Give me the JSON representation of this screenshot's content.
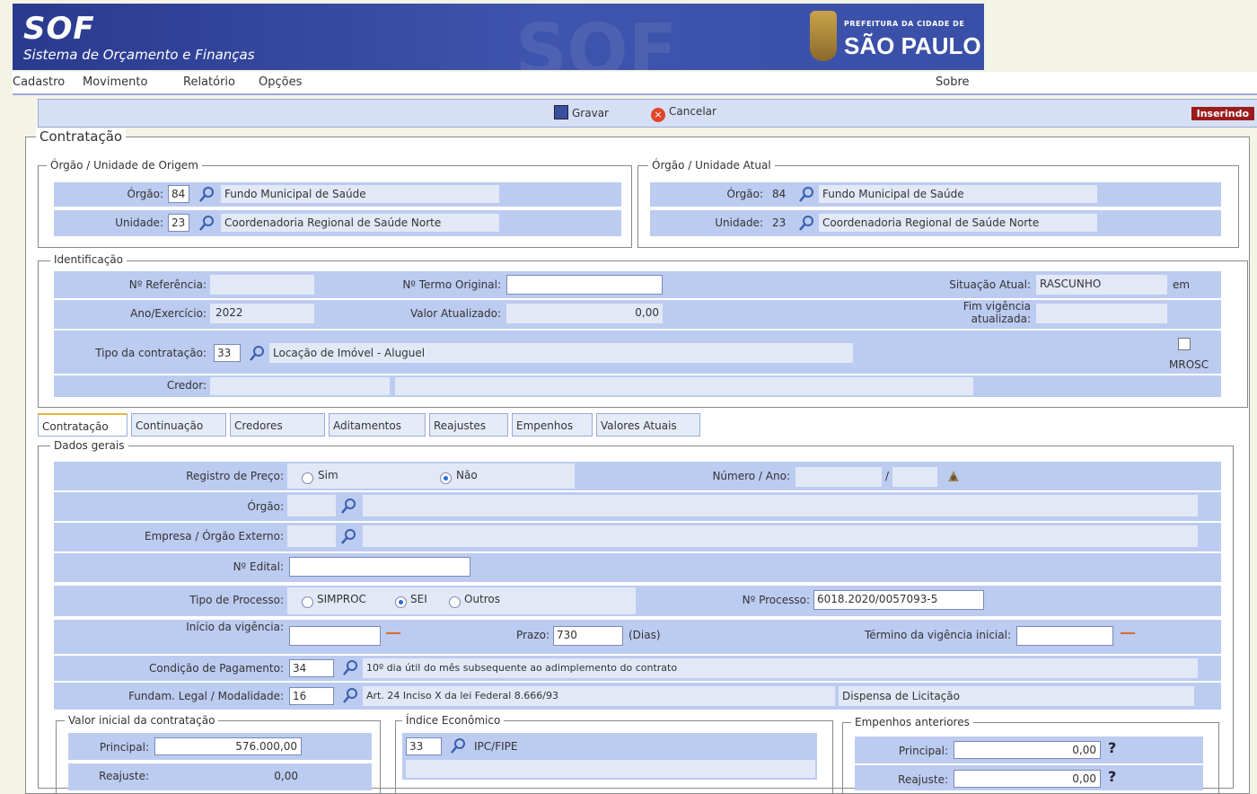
{
  "header": {
    "app_name": "SOF",
    "app_subtitle": "Sistema de Orçamento e Finanças",
    "pref_small": "PREFEITURA DA CIDADE DE",
    "pref_big": "SÃO PAULO"
  },
  "menu": {
    "cadastro": "Cadastro",
    "movimento": "Movimento",
    "relatorio": "Relatório",
    "opcoes": "Opções",
    "sobre": "Sobre"
  },
  "toolbar": {
    "save_label": "Gravar",
    "cancel_label": "Cancelar",
    "status": "Inserindo"
  },
  "contratacao_legend": "Contratação",
  "origem": {
    "legend": "Órgão / Unidade de Origem",
    "orgao_label": "Órgão:",
    "orgao_code": "84",
    "orgao_name": "Fundo Municipal de Saúde",
    "unidade_label": "Unidade:",
    "unidade_code": "23",
    "unidade_name": "Coordenadoria Regional de Saúde Norte"
  },
  "atual": {
    "legend": "Órgão / Unidade Atual",
    "orgao_label": "Órgão:",
    "orgao_code": "84",
    "orgao_name": "Fundo Municipal de Saúde",
    "unidade_label": "Unidade:",
    "unidade_code": "23",
    "unidade_name": "Coordenadoria Regional de Saúde Norte"
  },
  "identificacao": {
    "legend": "Identificação",
    "ref_label": "Nº Referência:",
    "termo_label": "Nº Termo Original:",
    "situacao_label": "Situação Atual:",
    "situacao_value": "RASCUNHO",
    "em_label": "em",
    "ano_label": "Ano/Exercício:",
    "ano_value": "2022",
    "valor_label": "Valor Atualizado:",
    "valor_value": "0,00",
    "fim_label": "Fim vigência atualizada:",
    "tipo_label": "Tipo da contratação:",
    "tipo_code": "33",
    "tipo_value": "Locação de Imóvel - Aluguel",
    "mrosc_label": "MROSC",
    "credor_label": "Credor:"
  },
  "tabs": [
    "Contratação",
    "Continuação",
    "Credores",
    "Aditamentos",
    "Reajustes",
    "Empenhos",
    "Valores Atuais"
  ],
  "dados": {
    "legend": "Dados gerais",
    "registro_label": "Registro de Preço:",
    "sim": "Sim",
    "nao": "Não",
    "numero_ano_label": "Número / Ano:",
    "slash": "/",
    "orgao_label": "Órgão:",
    "empresa_label": "Empresa / Órgão Externo:",
    "edital_label": "Nº Edital:",
    "tipo_proc_label": "Tipo de Processo:",
    "simproc": "SIMPROC",
    "sei": "SEI",
    "outros": "Outros",
    "processo_label": "Nº Processo:",
    "processo_value": "6018.2020/0057093-5",
    "inicio_label": "Início da vigência:",
    "prazo_label": "Prazo:",
    "prazo_value": "730",
    "dias": "(Dias)",
    "termino_label": "Término da vigência inicial:",
    "cond_label": "Condição de Pagamento:",
    "cond_code": "34",
    "cond_value": "10º dia útil do mês subsequente ao adimplemento do contrato",
    "fund_label": "Fundam. Legal / Modalidade:",
    "fund_code": "16",
    "fund_value": "Art. 24 Inciso X da lei Federal 8.666/93",
    "fund_extra": "Dispensa de Licitação"
  },
  "valor_inicial": {
    "legend": "Valor inicial da contratação",
    "principal_label": "Principal:",
    "principal_value": "576.000,00",
    "reajuste_label": "Reajuste:",
    "reajuste_value": "0,00"
  },
  "indice": {
    "legend": "Índice Econômico",
    "code": "33",
    "value": "IPC/FIPE"
  },
  "empenhos": {
    "legend": "Empenhos anteriores",
    "principal_label": "Principal:",
    "principal_value": "0,00",
    "reajuste_label": "Reajuste:",
    "reajuste_value": "0,00",
    "help": "?"
  }
}
